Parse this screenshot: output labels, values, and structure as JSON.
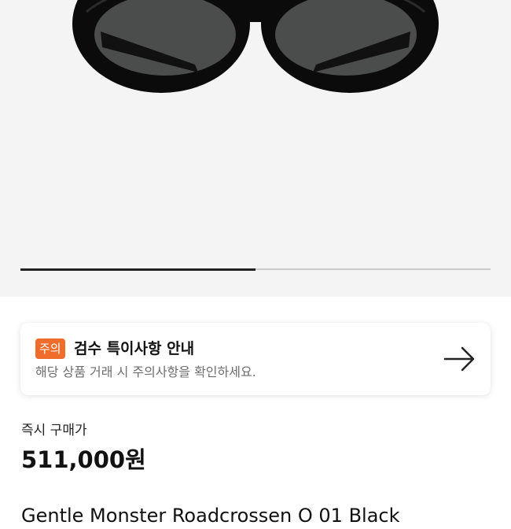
{
  "gallery": {
    "image": "sunglasses-photo",
    "progress": 0.5
  },
  "notice": {
    "badge": "주의",
    "title": "검수 특이사항 안내",
    "description": "해당 상품 거래 시 주의사항을 확인하세요.",
    "arrow_icon": "arrow-right-icon",
    "badge_color": "#ef6c2b"
  },
  "price": {
    "label": "즉시 구매가",
    "value": "511,000원"
  },
  "product": {
    "name": "Gentle Monster Roadcrossen O 01 Black"
  }
}
